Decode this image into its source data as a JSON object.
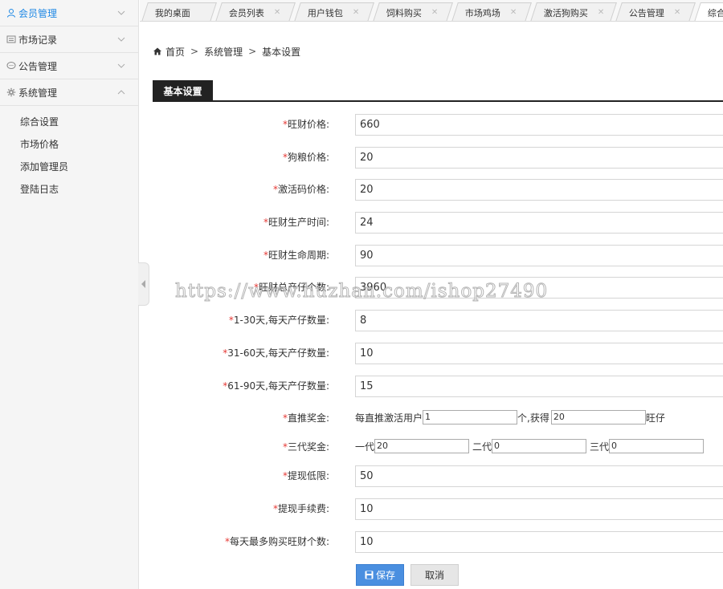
{
  "sidebar": {
    "menus": [
      {
        "label": "会员管理",
        "icon": "user-icon",
        "active": true,
        "expanded": false
      },
      {
        "label": "市场记录",
        "icon": "list-icon",
        "active": false,
        "expanded": false
      },
      {
        "label": "公告管理",
        "icon": "chat-bubble-icon",
        "active": false,
        "expanded": false
      },
      {
        "label": "系统管理",
        "icon": "gear-icon",
        "active": false,
        "expanded": true
      }
    ],
    "submenu": [
      "综合设置",
      "市场价格",
      "添加管理员",
      "登陆日志"
    ]
  },
  "tabs": [
    {
      "label": "我的桌面",
      "closable": false
    },
    {
      "label": "会员列表",
      "closable": true
    },
    {
      "label": "用户钱包",
      "closable": true
    },
    {
      "label": "饲料购买",
      "closable": true
    },
    {
      "label": "市场鸡场",
      "closable": true
    },
    {
      "label": "激活狗购买",
      "closable": true
    },
    {
      "label": "公告管理",
      "closable": true
    },
    {
      "label": "综合",
      "closable": false,
      "active": true
    }
  ],
  "breadcrumb": {
    "home": "首页",
    "section": "系统管理",
    "page": "基本设置",
    "separator": ">"
  },
  "section_title": "基本设置",
  "form": {
    "required_mark": "*",
    "fields": [
      {
        "label": "旺财价格:",
        "value": "660"
      },
      {
        "label": "狗粮价格:",
        "value": "20"
      },
      {
        "label": "激活码价格:",
        "value": "20"
      },
      {
        "label": "旺财生产时间:",
        "value": "24"
      },
      {
        "label": "旺财生命周期:",
        "value": "90"
      },
      {
        "label": "旺财总产仔个数:",
        "value": "3960"
      },
      {
        "label": "1-30天,每天产仔数量:",
        "value": "8"
      },
      {
        "label": "31-60天,每天产仔数量:",
        "value": "10"
      },
      {
        "label": "61-90天,每天产仔数量:",
        "value": "15"
      }
    ],
    "direct_bonus": {
      "label": "直推奖金:",
      "prefix": "每直推激活用户",
      "users_value": "1",
      "middle": "个,获得",
      "reward_value": "20",
      "suffix": "旺仔"
    },
    "three_gen": {
      "label": "三代奖金:",
      "gen1_label": "一代",
      "gen1_value": "20",
      "gen2_label": "二代",
      "gen2_value": "0",
      "gen3_label": "三代",
      "gen3_value": "0"
    },
    "fields_after": [
      {
        "label": "提现低限:",
        "value": "50"
      },
      {
        "label": "提现手续费:",
        "value": "10"
      },
      {
        "label": "每天最多购买旺财个数:",
        "value": "10"
      }
    ]
  },
  "buttons": {
    "save": "保存",
    "cancel": "取消"
  },
  "watermark": "https://www.huzhan.com/ishop27490",
  "colors": {
    "accent": "#1e88e5",
    "required": "#e53935",
    "save_button": "#4a8fe0",
    "section_header": "#222222"
  }
}
